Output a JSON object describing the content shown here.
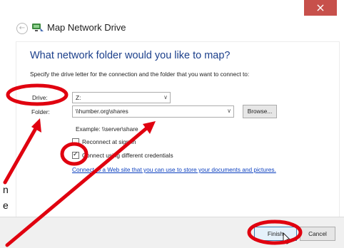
{
  "window": {
    "title": "Map Network Drive",
    "close_glyph": "×",
    "back_glyph": "←"
  },
  "dialog": {
    "heading": "What network folder would you like to map?",
    "instruction": "Specify the drive letter for the connection and the folder that you want to connect to:",
    "drive_label": "Drive:",
    "drive_value": "Z:",
    "folder_label": "Folder:",
    "folder_value": "\\\\humber.org\\shares",
    "browse_label": "Browse...",
    "example": "Example: \\\\server\\share",
    "reconnect_label": "Reconnect at sign-in",
    "reconnect_checked": false,
    "credentials_label": "Connect using different credentials",
    "credentials_checked": true,
    "link_text": "Connect to a Web site that you can use to store your documents and pictures."
  },
  "footer": {
    "finish_label": "Finish",
    "cancel_label": "Cancel"
  },
  "background_fragments": {
    "line1": "n",
    "line2": "e"
  },
  "icons": {
    "back": "back-arrow-icon",
    "title": "network-drive-icon",
    "close": "close-icon",
    "chevron": "chevron-down-icon",
    "cursor": "mouse-pointer-icon"
  },
  "colors": {
    "close": "#c7504b",
    "heading": "#1b3f8b",
    "link": "#0b3fbf",
    "annotation": "#e0000f"
  }
}
